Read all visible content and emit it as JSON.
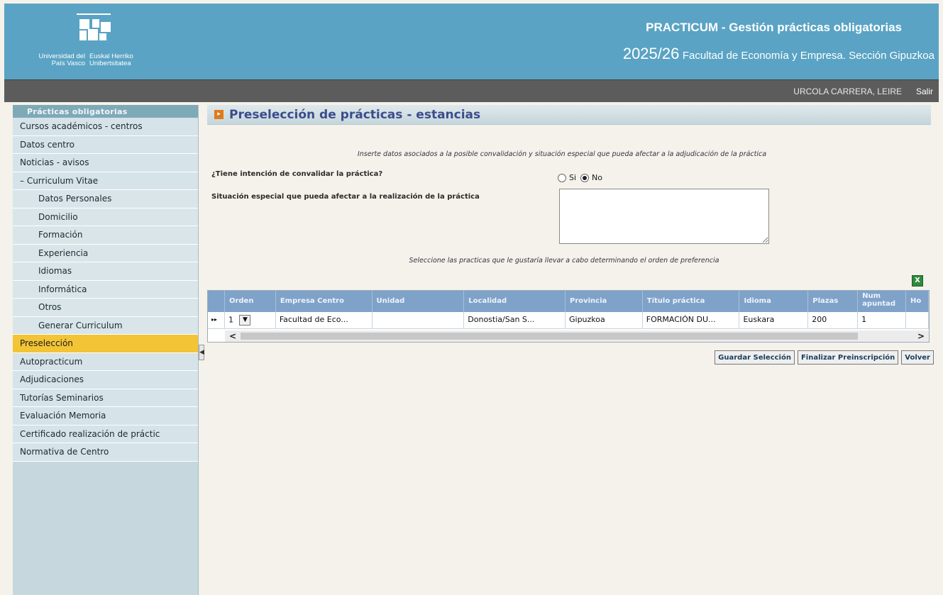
{
  "header": {
    "university_es": "Universidad del País Vasco",
    "university_eu": "Euskal Herriko Unibertsitatea",
    "app_title": "PRACTICUM - Gestión prácticas obligatorias",
    "year": "2025/26",
    "faculty": "Facultad de Economía y Empresa. Sección Gipuzkoa"
  },
  "userbar": {
    "user_name": "URCOLA CARRERA, LEIRE",
    "logout": "Salir"
  },
  "sidebar": {
    "heading": "Prácticas obligatorias",
    "items": [
      {
        "label": "Cursos académicos - centros"
      },
      {
        "label": "Datos centro"
      },
      {
        "label": "Noticias - avisos"
      },
      {
        "label": "– Curriculum Vitae"
      },
      {
        "label": "Datos Personales"
      },
      {
        "label": "Domicilio"
      },
      {
        "label": "Formación"
      },
      {
        "label": "Experiencia"
      },
      {
        "label": "Idiomas"
      },
      {
        "label": "Informática"
      },
      {
        "label": "Otros"
      },
      {
        "label": "Generar Curriculum"
      },
      {
        "label": "Preselección"
      },
      {
        "label": "Autopracticum"
      },
      {
        "label": "Adjudicaciones"
      },
      {
        "label": "Tutorías Seminarios"
      },
      {
        "label": "Evaluación Memoria"
      },
      {
        "label": "Certificado realización de práctic"
      },
      {
        "label": "Normativa de Centro"
      }
    ]
  },
  "main": {
    "page_title": "Preselección de prácticas - estancias",
    "intro": "Inserte datos asociados a la posible convalidación y situación especial que pueda afectar a la adjudicación de la práctica",
    "convalidar_question": "¿Tiene intención de convalidar la práctica?",
    "radio_si": "Si",
    "radio_no": "No",
    "special_question": "Situación especial que pueda afectar a la realización de la práctica",
    "special_value": "",
    "select_hint": "Seleccione las practicas que le gustaría llevar a cabo determinando el orden de preferencia",
    "grid": {
      "headers": [
        "Orden",
        "Empresa Centro",
        "Unidad",
        "Localidad",
        "Provincia",
        "Título práctica",
        "Idioma",
        "Plazas",
        "Num apuntad",
        "Ho"
      ],
      "row": {
        "orden": "1",
        "empresa": "Facultad de Eco...",
        "unidad": "",
        "localidad": "Donostia/San S...",
        "provincia": "Gipuzkoa",
        "titulo": "FORMACIÓN DU...",
        "idioma": "Euskara",
        "plazas": "200",
        "num_apuntados": "1",
        "ho": ""
      }
    },
    "buttons": {
      "save": "Guardar Selección",
      "finish": "Finalizar Preinscripción",
      "back": "Volver"
    }
  },
  "colors": {
    "header_bg": "#5aa3c4",
    "userbar_bg": "#5c5c5c",
    "sidebar_bg": "#c6d8de",
    "active_item": "#f2c436",
    "grid_header": "#7fa2c9",
    "title_text": "#3b4d8c"
  }
}
